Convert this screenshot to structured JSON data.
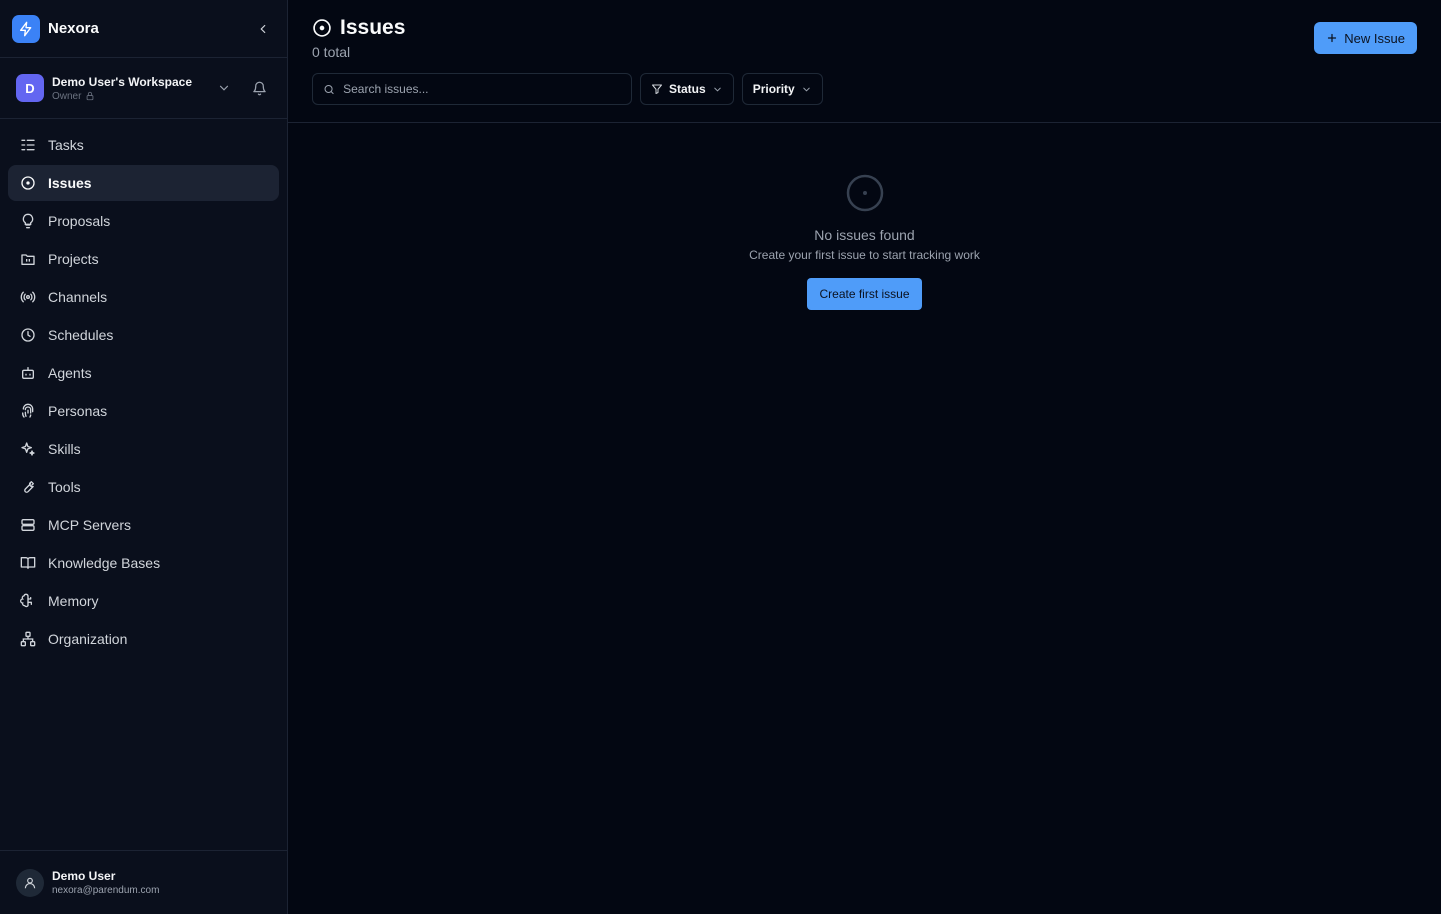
{
  "brand": {
    "name": "Nexora"
  },
  "workspace": {
    "initial": "D",
    "name": "Demo User's Workspace",
    "role": "Owner"
  },
  "nav": {
    "items": [
      {
        "label": "Tasks",
        "icon": "tasks-icon"
      },
      {
        "label": "Issues",
        "icon": "issues-icon",
        "active": true
      },
      {
        "label": "Proposals",
        "icon": "lightbulb-icon"
      },
      {
        "label": "Projects",
        "icon": "folder-icon"
      },
      {
        "label": "Channels",
        "icon": "broadcast-icon"
      },
      {
        "label": "Schedules",
        "icon": "clock-icon"
      },
      {
        "label": "Agents",
        "icon": "bot-icon"
      },
      {
        "label": "Personas",
        "icon": "fingerprint-icon"
      },
      {
        "label": "Skills",
        "icon": "sparkles-icon"
      },
      {
        "label": "Tools",
        "icon": "wrench-icon"
      },
      {
        "label": "MCP Servers",
        "icon": "server-icon"
      },
      {
        "label": "Knowledge Bases",
        "icon": "book-icon"
      },
      {
        "label": "Memory",
        "icon": "brain-icon"
      },
      {
        "label": "Organization",
        "icon": "network-icon"
      }
    ]
  },
  "user": {
    "name": "Demo User",
    "email": "nexora@parendum.com"
  },
  "header": {
    "title": "Issues",
    "subtitle": "0 total",
    "new_button": "New Issue",
    "search_placeholder": "Search issues...",
    "status_filter": "Status",
    "priority_filter": "Priority"
  },
  "empty": {
    "title": "No issues found",
    "description": "Create your first issue to start tracking work",
    "button": "Create first issue"
  },
  "colors": {
    "accent": "#4f9cf9",
    "background": "#030712",
    "sidebar": "#0a0f1c",
    "workspace_avatar": "#6366f1"
  }
}
